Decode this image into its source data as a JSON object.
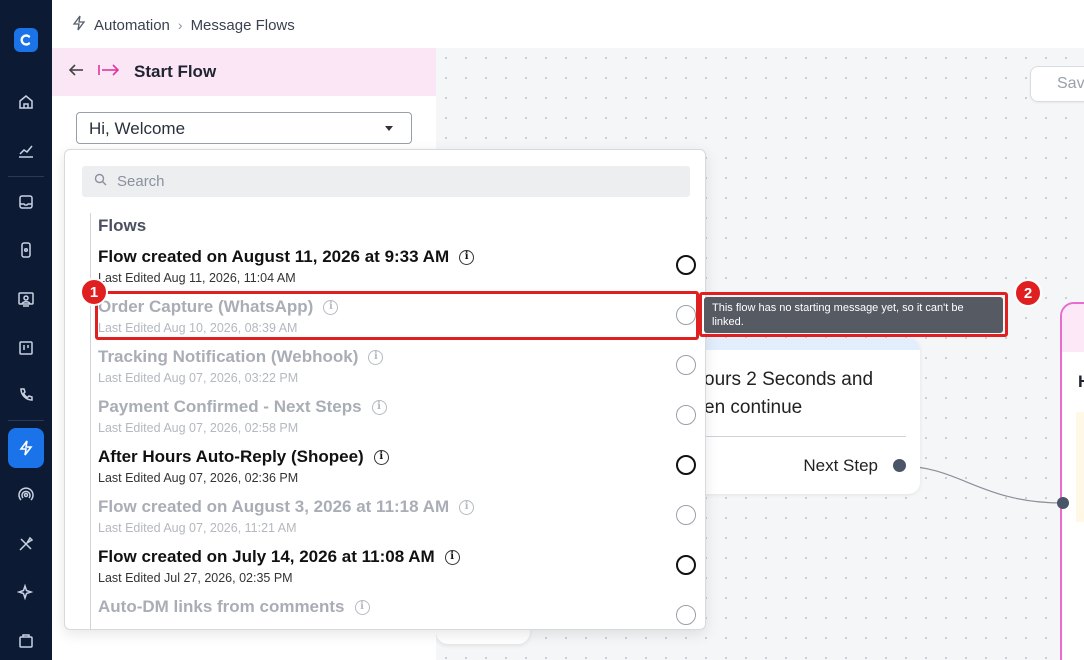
{
  "breadcrumb": {
    "section": "Automation",
    "page": "Message Flows"
  },
  "canvas": {
    "save_label": "Sav",
    "step_text_line1": "ours 2 Seconds and",
    "step_text_line2": "en continue",
    "next_step_label": "Next Step",
    "pink_card_letter": "H"
  },
  "panel": {
    "title": "Start Flow",
    "selected_flow": "Hi, Welcome"
  },
  "dropdown": {
    "search_placeholder": "Search",
    "group_label": "Flows",
    "items": [
      {
        "name": "Flow created on August 11, 2026 at 9:33 AM",
        "edited": "Last Edited Aug 11, 2026, 11:04 AM",
        "enabled": true
      },
      {
        "name": "Order Capture (WhatsApp)",
        "edited": "Last Edited Aug 10, 2026, 08:39 AM",
        "enabled": false
      },
      {
        "name": "Tracking Notification (Webhook)",
        "edited": "Last Edited Aug 07, 2026, 03:22 PM",
        "enabled": false
      },
      {
        "name": "Payment Confirmed - Next Steps",
        "edited": "Last Edited Aug 07, 2026, 02:58 PM",
        "enabled": false
      },
      {
        "name": "After Hours Auto-Reply (Shopee)",
        "edited": "Last Edited Aug 07, 2026, 02:36 PM",
        "enabled": true
      },
      {
        "name": "Flow created on August 3, 2026 at 11:18 AM",
        "edited": "Last Edited Aug 07, 2026, 11:21 AM",
        "enabled": false
      },
      {
        "name": "Flow created on July 14, 2026 at 11:08 AM",
        "edited": "Last Edited Jul 27, 2026, 02:35 PM",
        "enabled": true
      },
      {
        "name": "Auto-DM links from comments",
        "edited": "",
        "enabled": false
      }
    ]
  },
  "tooltip": {
    "text": "This flow has no starting message yet, so it can't be linked."
  },
  "annotations": {
    "badge1": "1",
    "badge2": "2"
  },
  "colors": {
    "rail": "#0c1b33",
    "accent": "#1a73e8",
    "panel_head": "#fbe6f6",
    "highlight": "#e02020"
  },
  "icons": {
    "rail": [
      "logo-icon",
      "home-icon",
      "analytics-icon",
      "inbox-icon",
      "device-icon",
      "contacts-icon",
      "board-icon",
      "phone-icon",
      "automation-icon",
      "broadcast-icon",
      "tools-icon",
      "ai-sparkle-icon",
      "store-icon"
    ]
  }
}
